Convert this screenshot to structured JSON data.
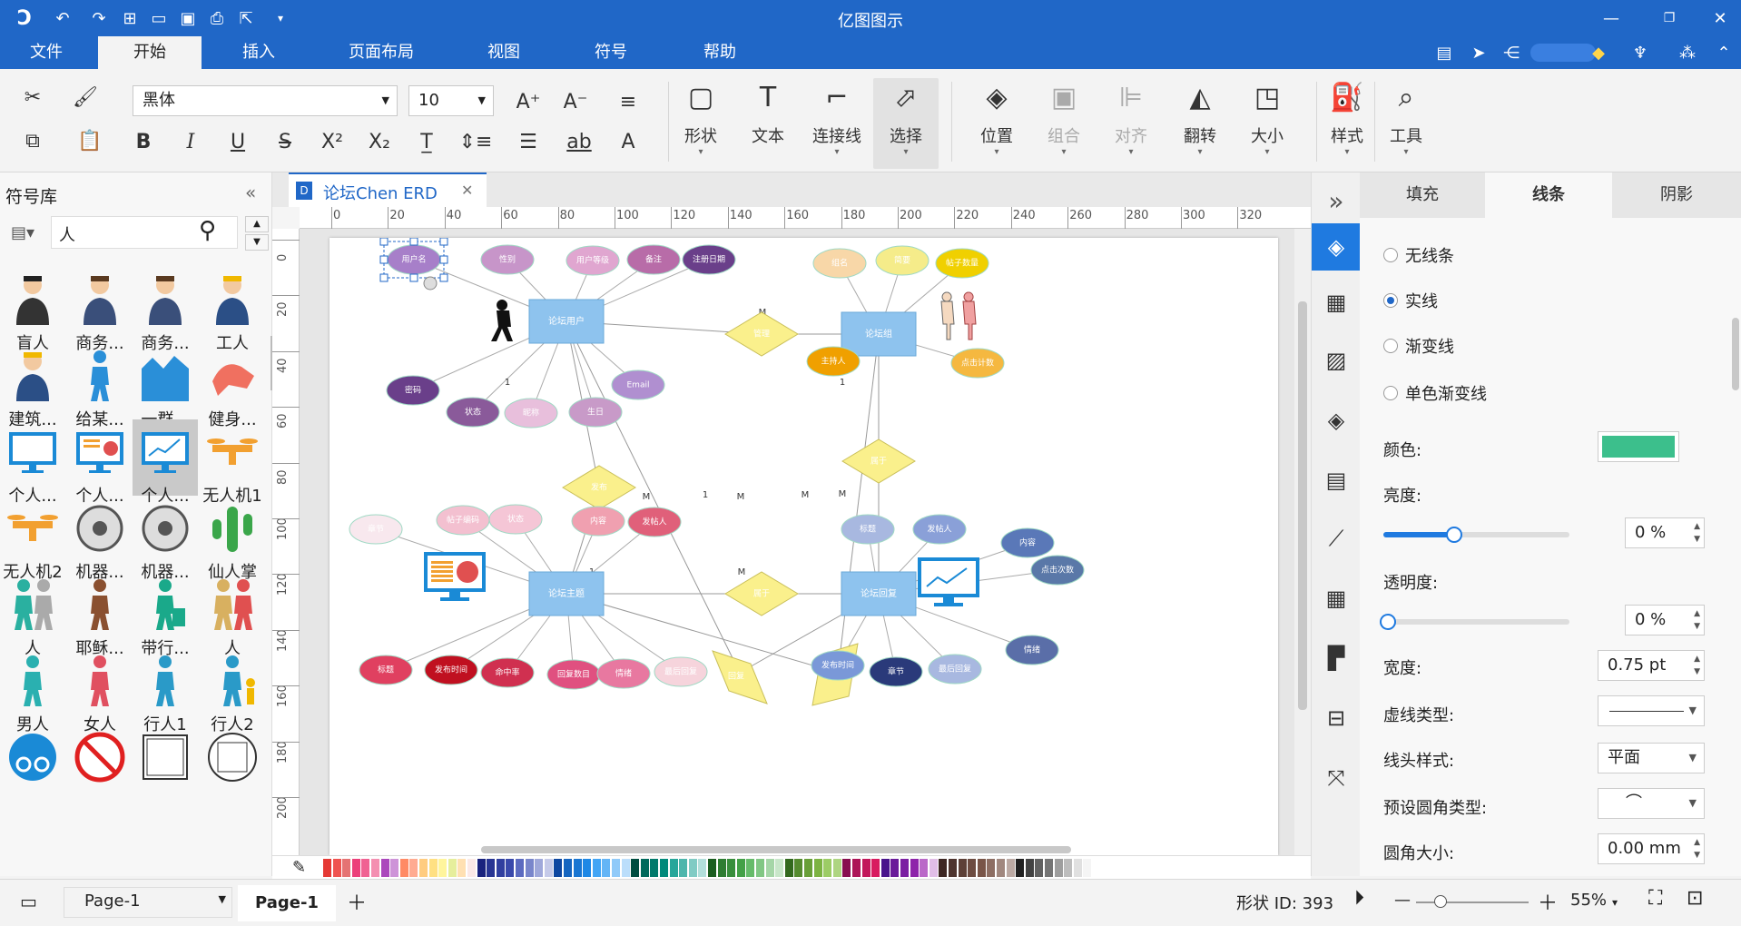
{
  "app": {
    "title": "亿图图示"
  },
  "menus": [
    "文件",
    "开始",
    "插入",
    "页面布局",
    "视图",
    "符号",
    "帮助"
  ],
  "active_menu": "开始",
  "ribbon": {
    "font_name": "黑体",
    "font_size": "10",
    "tools": [
      {
        "icon": "shape-icon",
        "label": "形状"
      },
      {
        "icon": "text-icon",
        "label": "文本"
      },
      {
        "icon": "connector-icon",
        "label": "连接线"
      },
      {
        "icon": "select-icon",
        "label": "选择"
      }
    ],
    "arrange": [
      {
        "icon": "layers-icon",
        "label": "位置"
      },
      {
        "icon": "group-icon",
        "label": "组合"
      },
      {
        "icon": "align-icon",
        "label": "对齐"
      },
      {
        "icon": "flip-icon",
        "label": "翻转"
      },
      {
        "icon": "size-icon",
        "label": "大小"
      }
    ],
    "style_label": "样式",
    "tools_label": "工具"
  },
  "library": {
    "title": "符号库",
    "search_value": "人",
    "symbols": [
      {
        "name": "盲人",
        "kind": "person"
      },
      {
        "name": "商务...",
        "kind": "business"
      },
      {
        "name": "商务...",
        "kind": "business"
      },
      {
        "name": "工人",
        "kind": "worker"
      },
      {
        "name": "建筑...",
        "kind": "worker"
      },
      {
        "name": "给某...",
        "kind": "kick"
      },
      {
        "name": "一群...",
        "kind": "crowd"
      },
      {
        "name": "健身...",
        "kind": "fitness"
      },
      {
        "name": "个人...",
        "kind": "monitor"
      },
      {
        "name": "个人...",
        "kind": "monitor-chart"
      },
      {
        "name": "个人...",
        "kind": "monitor-line"
      },
      {
        "name": "无人机1",
        "kind": "drone"
      },
      {
        "name": "无人机2",
        "kind": "drone"
      },
      {
        "name": "机器...",
        "kind": "robot"
      },
      {
        "name": "机器...",
        "kind": "robot"
      },
      {
        "name": "仙人掌",
        "kind": "cactus"
      },
      {
        "name": "人",
        "kind": "couple"
      },
      {
        "name": "耶稣...",
        "kind": "jesus"
      },
      {
        "name": "带行...",
        "kind": "luggage"
      },
      {
        "name": "人",
        "kind": "couple2"
      },
      {
        "name": "男人",
        "kind": "man"
      },
      {
        "name": "女人",
        "kind": "woman"
      },
      {
        "name": "行人1",
        "kind": "walker"
      },
      {
        "name": "行人2",
        "kind": "family"
      },
      {
        "name": "",
        "kind": "bike-sign"
      },
      {
        "name": "",
        "kind": "no-walk"
      },
      {
        "name": "",
        "kind": "frame"
      },
      {
        "name": "",
        "kind": "frame-round"
      }
    ]
  },
  "document_tab": "论坛Chen ERD",
  "hruler_ticks": [
    "0",
    "20",
    "40",
    "60",
    "80",
    "100",
    "120",
    "140",
    "160",
    "180",
    "200",
    "220",
    "240",
    "260",
    "280",
    "300",
    "320"
  ],
  "vruler_ticks": [
    "0",
    "20",
    "40",
    "60",
    "80",
    "100",
    "120",
    "140",
    "160",
    "180",
    "200"
  ],
  "diagram": {
    "entities": [
      {
        "id": "e1",
        "label": "论坛用户"
      },
      {
        "id": "e2",
        "label": "论坛组"
      },
      {
        "id": "e3",
        "label": "论坛主题"
      },
      {
        "id": "e4",
        "label": "论坛回复"
      }
    ],
    "relations": [
      {
        "id": "r1",
        "label": "管理"
      },
      {
        "id": "r2",
        "label": "发布"
      },
      {
        "id": "r3",
        "label": "属于"
      },
      {
        "id": "r4",
        "label": "回复"
      },
      {
        "id": "r5",
        "label": "发表"
      },
      {
        "id": "r6",
        "label": "属于"
      }
    ],
    "cardinalities": [
      "1",
      "M",
      "1",
      "M",
      "1",
      "M",
      "M",
      "M",
      "1",
      "M",
      "1",
      "M"
    ],
    "attributes": [
      {
        "label": "用户名",
        "color": "#a77fc9"
      },
      {
        "label": "性别",
        "color": "#c795c9"
      },
      {
        "label": "用户等级",
        "color": "#e0a6d0"
      },
      {
        "label": "备注",
        "color": "#b86ca8"
      },
      {
        "label": "注册日期",
        "color": "#6a3f8a"
      },
      {
        "label": "密码",
        "color": "#6a3f8a"
      },
      {
        "label": "状态",
        "color": "#8a5a9a"
      },
      {
        "label": "昵称",
        "color": "#e8bfdc"
      },
      {
        "label": "生日",
        "color": "#c89ac8"
      },
      {
        "label": "Email",
        "color": "#b08fd0"
      },
      {
        "label": "组名",
        "color": "#f8d7a8"
      },
      {
        "label": "简要",
        "color": "#f5ec8a"
      },
      {
        "label": "帖子数量",
        "color": "#f0d000"
      },
      {
        "label": "主持人",
        "color": "#f0a000"
      },
      {
        "label": "点击计数",
        "color": "#f5b840"
      },
      {
        "label": "章节",
        "color": "#f8e8ee"
      },
      {
        "label": "帖子编码",
        "color": "#f3c0d0"
      },
      {
        "label": "状态",
        "color": "#f5c6d6"
      },
      {
        "label": "内容",
        "color": "#f0a0b0"
      },
      {
        "label": "发帖人",
        "color": "#e0607a"
      },
      {
        "label": "标题",
        "color": "#e04060"
      },
      {
        "label": "发布时间",
        "color": "#c01020"
      },
      {
        "label": "命中率",
        "color": "#d03050"
      },
      {
        "label": "回复数目",
        "color": "#e05080"
      },
      {
        "label": "情绪",
        "color": "#e878a0"
      },
      {
        "label": "最后回复",
        "color": "#f6d4dc"
      },
      {
        "label": "标题",
        "color": "#a8b8e0"
      },
      {
        "label": "发帖人",
        "color": "#8aa0d8"
      },
      {
        "label": "内容",
        "color": "#5a78b8"
      },
      {
        "label": "点击次数",
        "color": "#5a78a8"
      },
      {
        "label": "发布时间",
        "color": "#7a98d8"
      },
      {
        "label": "章节",
        "color": "#2a3a7a"
      },
      {
        "label": "最后回复",
        "color": "#a8b8e0"
      },
      {
        "label": "情绪",
        "color": "#5a6ea8"
      }
    ]
  },
  "palette": [
    "#e53935",
    "#ef5350",
    "#e57373",
    "#ec407a",
    "#f06292",
    "#f48fb1",
    "#ab47bc",
    "#ce93d8",
    "#ff8a65",
    "#ffab91",
    "#ffcc80",
    "#ffe082",
    "#fff59d",
    "#e6ee9c",
    "#ffe0b2",
    "#fbe9e7",
    "#1a237e",
    "#283593",
    "#303f9f",
    "#3949ab",
    "#5c6bc0",
    "#7986cb",
    "#9fa8da",
    "#c5cae9",
    "#0d47a1",
    "#1565c0",
    "#1976d2",
    "#1e88e5",
    "#42a5f5",
    "#64b5f6",
    "#90caf9",
    "#bbdefb",
    "#004d40",
    "#00695c",
    "#00796b",
    "#00897b",
    "#26a69a",
    "#4db6ac",
    "#80cbc4",
    "#b2dfdb",
    "#1b5e20",
    "#2e7d32",
    "#388e3c",
    "#43a047",
    "#66bb6a",
    "#81c784",
    "#a5d6a7",
    "#c8e6c9",
    "#33691e",
    "#558b2f",
    "#689f38",
    "#7cb342",
    "#9ccc65",
    "#aed581",
    "#880e4f",
    "#ad1457",
    "#c2185b",
    "#d81b60",
    "#4a148c",
    "#6a1b9a",
    "#7b1fa2",
    "#8e24aa",
    "#ba68c8",
    "#e1bee7",
    "#3e2723",
    "#4e342e",
    "#5d4037",
    "#6d4c41",
    "#795548",
    "#8d6e63",
    "#a1887f",
    "#bcaaa4",
    "#212121",
    "#424242",
    "#616161",
    "#757575",
    "#9e9e9e",
    "#bdbdbd",
    "#e0e0e0",
    "#f5f5f5"
  ],
  "right_tabs": [
    "填充",
    "线条",
    "阴影"
  ],
  "right_active_tab": "线条",
  "line": {
    "options": [
      "无线条",
      "实线",
      "渐变线",
      "单色渐变线"
    ],
    "selected": "实线",
    "color_label": "颜色:",
    "color": "#3cbf8c",
    "brightness_label": "亮度:",
    "brightness_value": "0 %",
    "brightness": 0.38,
    "transparency_label": "透明度:",
    "transparency_value": "0 %",
    "transparency": 0,
    "width_label": "宽度:",
    "width_value": "0.75 pt",
    "dash_label": "虚线类型:",
    "cap_label": "线头样式:",
    "cap_value": "平面",
    "corner_type_label": "预设圆角类型:",
    "corner_size_label": "圆角大小:",
    "corner_size_value": "0.00 mm"
  },
  "status": {
    "page_select": "Page-1",
    "page_tab": "Page-1",
    "shape_id": "形状 ID:  393",
    "zoom": "55%",
    "zoom_level": 0.22
  }
}
